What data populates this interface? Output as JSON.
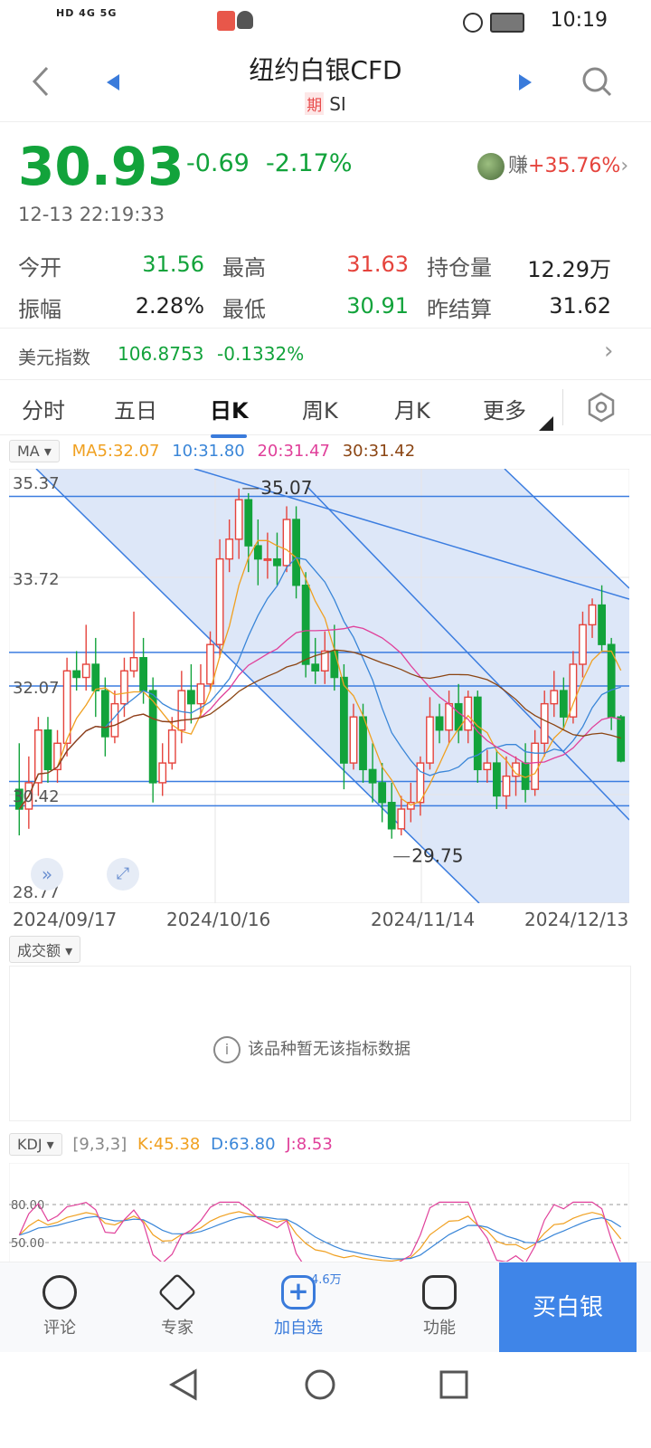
{
  "status_bar": {
    "signal_text": "HD 4G 5G",
    "time": "10:19"
  },
  "header": {
    "title": "纽约白银CFD",
    "tag": "期",
    "code": "SI"
  },
  "quote": {
    "price": "30.93",
    "change": "-0.69",
    "change_pct": "-2.17%",
    "timestamp": "12-13 22:19:33",
    "profit_prefix": "赚",
    "profit": "+35.76%"
  },
  "stats": {
    "open_label": "今开",
    "open": "31.56",
    "high_label": "最高",
    "high": "31.63",
    "oi_label": "持仓量",
    "oi": "12.29万",
    "amp_label": "振幅",
    "amp": "2.28%",
    "low_label": "最低",
    "low": "30.91",
    "settle_label": "昨结算",
    "settle": "31.62"
  },
  "usd_index": {
    "label": "美元指数",
    "value": "106.8753",
    "change": "-0.1332%"
  },
  "tabs": [
    "分时",
    "五日",
    "日K",
    "周K",
    "月K",
    "更多"
  ],
  "ma": {
    "selector": "MA",
    "ma5": "MA5:32.07",
    "ma10": "10:31.80",
    "ma20": "20:31.47",
    "ma30": "30:31.42"
  },
  "price_axis": [
    "35.37",
    "33.72",
    "32.07",
    "30.42",
    "28.77"
  ],
  "annotations": {
    "high": "35.07",
    "low": "29.75"
  },
  "dates": [
    "2024/09/17",
    "2024/10/16",
    "2024/11/14",
    "2024/12/13"
  ],
  "volume": {
    "selector": "成交额",
    "message": "该品种暂无该指标数据"
  },
  "kdj": {
    "selector": "KDJ",
    "params": "[9,3,3]",
    "k": "K:45.38",
    "d": "D:63.80",
    "j": "J:8.53",
    "levels": [
      "80.00",
      "50.00"
    ]
  },
  "bottom_bar": {
    "comment": "评论",
    "expert": "专家",
    "add": "加自选",
    "add_badge": "4.6万",
    "function": "功能",
    "buy": "买白银"
  },
  "colors": {
    "up": "#e5433c",
    "down": "#12a33b",
    "accent": "#3f85e8",
    "ma5": "#f0a020",
    "ma10": "#3a86d8",
    "ma20": "#e0409a",
    "ma30": "#8b4513"
  },
  "chart_data": {
    "type": "candlestick",
    "x": [
      "2024/09/17",
      "2024/10/16",
      "2024/11/14",
      "2024/12/13"
    ],
    "ylim": [
      28.77,
      35.37
    ],
    "candles": [
      [
        30.5,
        30.2,
        31.2,
        29.8
      ],
      [
        30.2,
        30.6,
        31.0,
        29.9
      ],
      [
        30.6,
        31.4,
        31.6,
        30.4
      ],
      [
        31.4,
        30.8,
        31.6,
        30.6
      ],
      [
        30.8,
        31.2,
        31.4,
        30.6
      ],
      [
        31.2,
        32.3,
        32.5,
        31.0
      ],
      [
        32.3,
        32.2,
        32.6,
        32.0
      ],
      [
        32.2,
        32.4,
        33.0,
        32.0
      ],
      [
        32.4,
        32.0,
        32.8,
        31.6
      ],
      [
        32.0,
        31.3,
        32.2,
        31.0
      ],
      [
        31.3,
        31.8,
        32.0,
        31.2
      ],
      [
        31.8,
        32.3,
        32.5,
        31.6
      ],
      [
        32.3,
        32.5,
        33.2,
        32.2
      ],
      [
        32.5,
        32.0,
        32.8,
        31.8
      ],
      [
        32.0,
        30.6,
        32.2,
        30.3
      ],
      [
        30.6,
        30.9,
        31.2,
        30.4
      ],
      [
        30.9,
        31.4,
        31.6,
        30.8
      ],
      [
        31.4,
        32.0,
        32.3,
        31.2
      ],
      [
        32.0,
        31.8,
        32.4,
        31.5
      ],
      [
        31.8,
        32.1,
        32.4,
        31.6
      ],
      [
        32.1,
        32.7,
        32.9,
        32.0
      ],
      [
        32.7,
        34.0,
        34.3,
        32.5
      ],
      [
        34.0,
        34.3,
        34.6,
        33.8
      ],
      [
        34.3,
        34.9,
        35.07,
        34.0
      ],
      [
        34.9,
        34.2,
        35.0,
        33.8
      ],
      [
        34.2,
        34.0,
        34.6,
        33.6
      ],
      [
        34.0,
        34.0,
        34.4,
        33.7
      ],
      [
        34.0,
        33.9,
        34.4,
        33.6
      ],
      [
        33.9,
        34.6,
        34.8,
        33.8
      ],
      [
        34.6,
        33.6,
        34.8,
        33.4
      ],
      [
        33.6,
        32.4,
        33.8,
        32.2
      ],
      [
        32.4,
        32.3,
        32.8,
        32.1
      ],
      [
        32.3,
        32.6,
        32.9,
        32.1
      ],
      [
        32.6,
        32.2,
        33.0,
        32.0
      ],
      [
        32.2,
        30.9,
        32.4,
        30.5
      ],
      [
        30.9,
        31.6,
        31.8,
        30.8
      ],
      [
        31.6,
        30.8,
        31.8,
        30.6
      ],
      [
        30.8,
        30.6,
        31.2,
        30.3
      ],
      [
        30.6,
        30.3,
        30.9,
        30.0
      ],
      [
        30.3,
        29.9,
        30.6,
        29.75
      ],
      [
        29.9,
        30.2,
        30.4,
        29.8
      ],
      [
        30.2,
        30.3,
        30.6,
        30.0
      ],
      [
        30.3,
        30.9,
        31.0,
        30.1
      ],
      [
        30.9,
        31.6,
        31.9,
        30.8
      ],
      [
        31.6,
        31.4,
        31.8,
        31.2
      ],
      [
        31.4,
        31.8,
        32.0,
        31.2
      ],
      [
        31.8,
        31.4,
        32.1,
        31.2
      ],
      [
        31.4,
        31.9,
        32.0,
        31.2
      ],
      [
        31.9,
        30.8,
        32.0,
        30.6
      ],
      [
        30.8,
        30.9,
        31.1,
        30.6
      ],
      [
        30.9,
        30.4,
        31.1,
        30.2
      ],
      [
        30.4,
        30.7,
        31.0,
        30.2
      ],
      [
        30.7,
        30.9,
        31.0,
        30.4
      ],
      [
        30.9,
        30.5,
        31.2,
        30.3
      ],
      [
        30.5,
        31.2,
        31.4,
        30.4
      ],
      [
        31.2,
        31.8,
        32.0,
        31.0
      ],
      [
        31.8,
        32.0,
        32.3,
        31.6
      ],
      [
        32.0,
        31.6,
        32.2,
        31.4
      ],
      [
        31.6,
        32.4,
        32.6,
        31.5
      ],
      [
        32.4,
        33.0,
        33.2,
        32.2
      ],
      [
        33.0,
        33.3,
        33.4,
        32.8
      ],
      [
        33.3,
        32.7,
        33.6,
        32.6
      ],
      [
        32.7,
        31.6,
        32.8,
        31.4
      ],
      [
        31.6,
        30.93,
        31.63,
        30.91
      ]
    ]
  }
}
